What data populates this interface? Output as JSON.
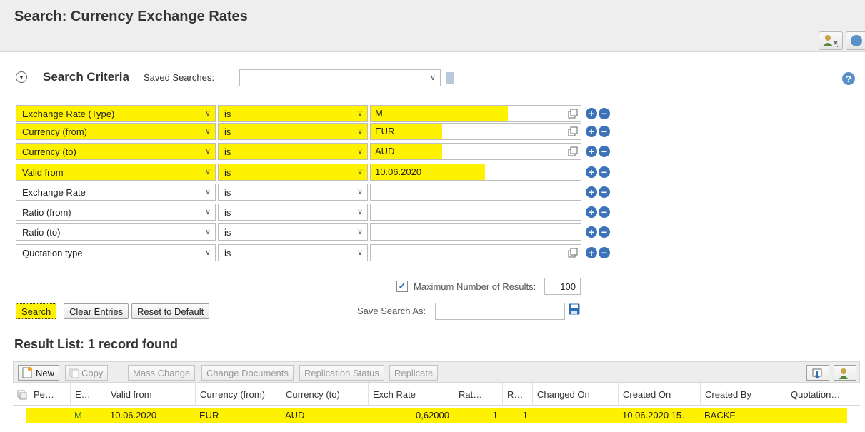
{
  "page": {
    "title": "Search: Currency Exchange Rates"
  },
  "search_criteria": {
    "title": "Search Criteria",
    "saved_searches_label": "Saved Searches:",
    "saved_searches_value": "",
    "rows": [
      {
        "field": "Exchange Rate (Type)",
        "operator": "is",
        "value": "M",
        "highlighted": true,
        "value_help": true
      },
      {
        "field": "Currency (from)",
        "operator": "is",
        "value": "EUR",
        "highlighted": true,
        "value_help": true
      },
      {
        "field": "Currency (to)",
        "operator": "is",
        "value": "AUD",
        "highlighted": true,
        "value_help": true
      },
      {
        "field": "Valid from",
        "operator": "is",
        "value": "10.06.2020",
        "highlighted": true,
        "value_help": false
      },
      {
        "field": "Exchange Rate",
        "operator": "is",
        "value": "",
        "highlighted": false,
        "value_help": false
      },
      {
        "field": "Ratio (from)",
        "operator": "is",
        "value": "",
        "highlighted": false,
        "value_help": false
      },
      {
        "field": "Ratio (to)",
        "operator": "is",
        "value": "",
        "highlighted": false,
        "value_help": false
      },
      {
        "field": "Quotation type",
        "operator": "is",
        "value": "",
        "highlighted": false,
        "value_help": true
      }
    ],
    "max_results_label": "Maximum Number of Results:",
    "max_results_checked": true,
    "max_results_value": "100",
    "buttons": {
      "search": "Search",
      "clear": "Clear Entries",
      "reset": "Reset to Default"
    },
    "save_search_label": "Save Search As:",
    "save_search_value": ""
  },
  "result_list": {
    "title": "Result List: 1 record found",
    "toolbar": {
      "new": "New",
      "copy": "Copy",
      "mass_change": "Mass Change",
      "change_documents": "Change Documents",
      "replication_status": "Replication Status",
      "replicate": "Replicate"
    },
    "columns": [
      "Pe…",
      "E…",
      "Valid from",
      "Currency (from)",
      "Currency (to)",
      "Exch Rate",
      "Rat…",
      "R…",
      "Changed On",
      "Created On",
      "Created By",
      "Quotation…"
    ],
    "rows": [
      {
        "period": "",
        "exchange_type": "M",
        "valid_from": "10.06.2020",
        "currency_from": "EUR",
        "currency_to": "AUD",
        "exch_rate": "0,62000",
        "ratio_from": "1",
        "ratio_to": "1",
        "changed_on": "",
        "created_on": "10.06.2020 15…",
        "created_by": "BACKF",
        "quotation": ""
      }
    ]
  },
  "colors": {
    "highlight": "#fff200",
    "accent_blue": "#3b72b8",
    "help_blue": "#5a91c8",
    "header_bg": "#eeeeee"
  }
}
